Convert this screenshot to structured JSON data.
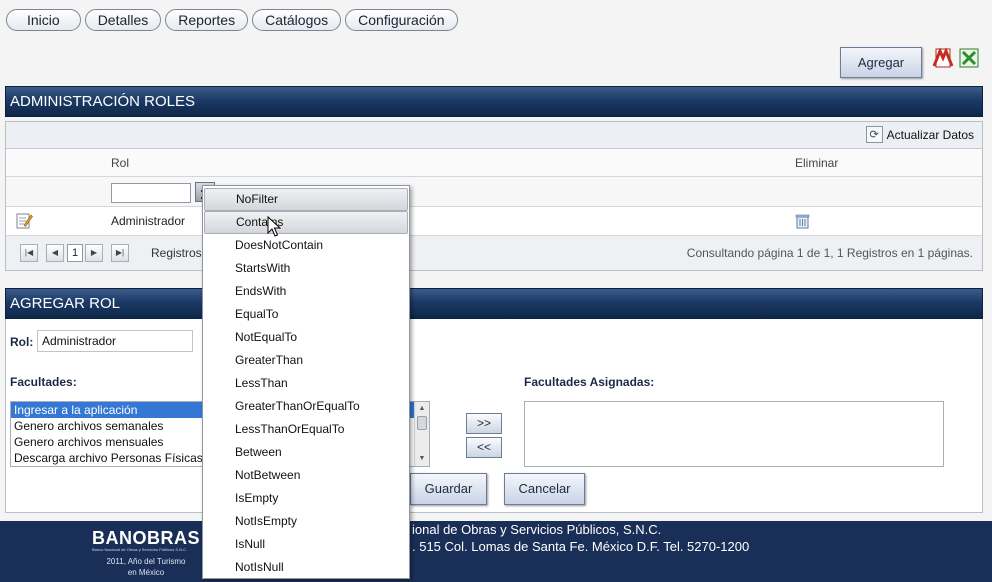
{
  "nav": {
    "tabs": [
      "Inicio",
      "Detalles",
      "Reportes",
      "Catálogos",
      "Configuración"
    ]
  },
  "toolbar": {
    "agregar_label": "Agregar"
  },
  "roles_section": {
    "title": "ADMINISTRACIÓN ROLES",
    "refresh_label": "Actualizar Datos",
    "columns": {
      "rol": "Rol",
      "eliminar": "Eliminar"
    },
    "rows": [
      {
        "rol": "Administrador"
      }
    ],
    "pager": {
      "page_value": "1",
      "registros_label": "Registros",
      "status": "Consultando página 1 de 1, 1 Registros en 1 páginas."
    }
  },
  "filter_menu": {
    "highlighted": "Contains",
    "options": [
      "NoFilter",
      "Contains",
      "DoesNotContain",
      "StartsWith",
      "EndsWith",
      "EqualTo",
      "NotEqualTo",
      "GreaterThan",
      "LessThan",
      "GreaterThanOrEqualTo",
      "LessThanOrEqualTo",
      "Between",
      "NotBetween",
      "IsEmpty",
      "NotIsEmpty",
      "IsNull",
      "NotIsNull"
    ]
  },
  "agregar_rol": {
    "title": "AGREGAR ROL",
    "rol_label": "Rol:",
    "rol_value": "Administrador",
    "facultades_label": "Facultades:",
    "asignadas_label": "Facultades Asignadas:",
    "facultades": [
      {
        "label": "Ingresar a la aplicación",
        "selected": true
      },
      {
        "label": "Genero archivos semanales",
        "selected": false
      },
      {
        "label": "Genero archivos mensuales",
        "selected": false
      },
      {
        "label": "Descarga archivo Personas Físicas",
        "selected": false
      }
    ],
    "move_right": ">>",
    "move_left": "<<",
    "guardar_label": "Guardar",
    "cancelar_label": "Cancelar"
  },
  "footer": {
    "logo": "BANOBRAS",
    "logo_sub": "Banco Nacional de Obras y Servicios Públicos S.N.C.",
    "year_line1": "2011, Año del Turismo",
    "year_line2": "en México",
    "line1": "ional de Obras y Servicios Públicos, S.N.C.",
    "line2": ". 515 Col. Lomas de Santa Fe. México D.F. Tel. 5270-1200"
  },
  "colors": {
    "header_blue": "#1c3a66",
    "footer_blue": "#1a2f57",
    "selected_item": "#3477d4"
  }
}
